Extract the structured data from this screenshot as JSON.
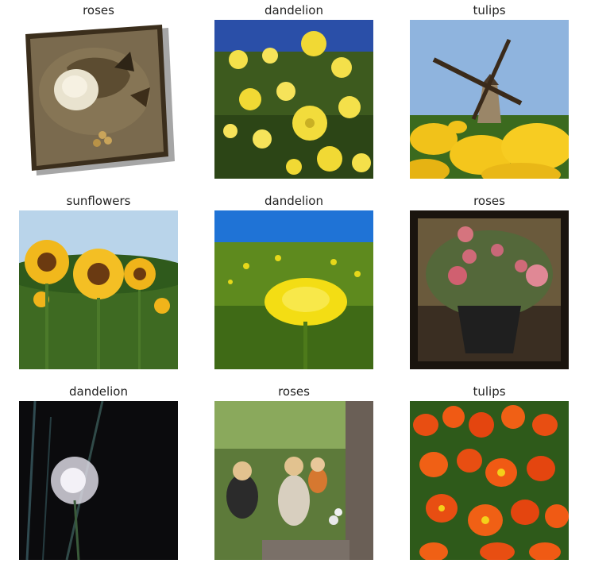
{
  "grid": {
    "cells": [
      {
        "label": "roses"
      },
      {
        "label": "dandelion"
      },
      {
        "label": "tulips"
      },
      {
        "label": "sunflowers"
      },
      {
        "label": "dandelion"
      },
      {
        "label": "roses"
      },
      {
        "label": "dandelion"
      },
      {
        "label": "roses"
      },
      {
        "label": "tulips"
      }
    ]
  }
}
